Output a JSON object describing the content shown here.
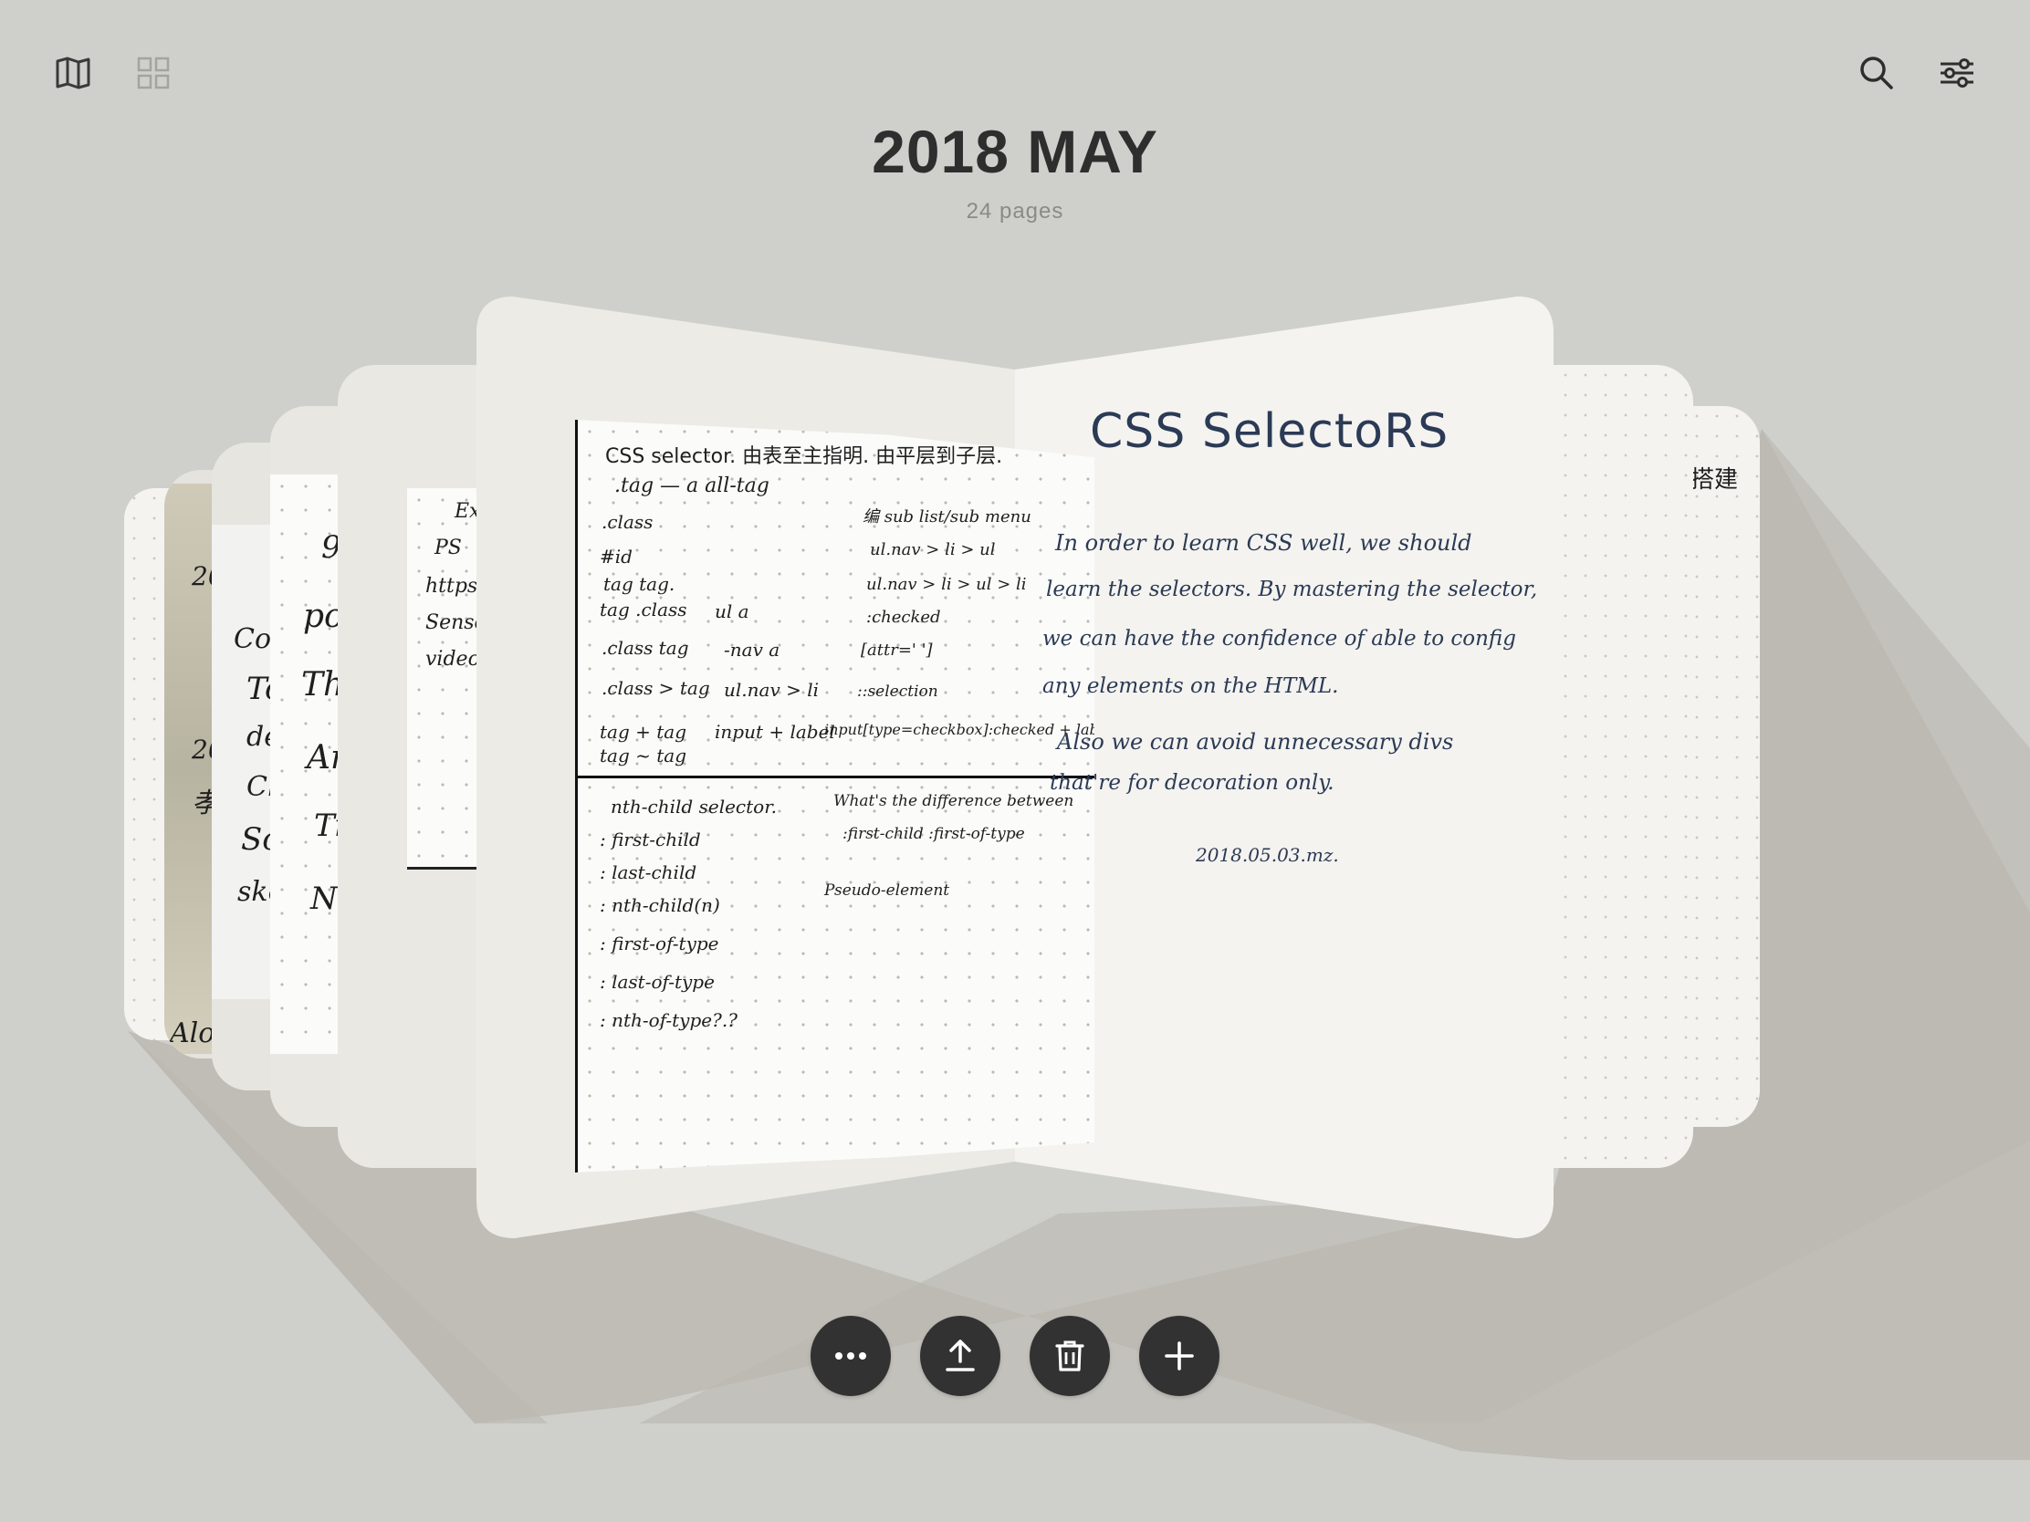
{
  "header": {
    "title": "2018 MAY",
    "subtitle": "24 pages"
  },
  "toolbar": {
    "left_icons": [
      "book-icon",
      "grid-icon"
    ],
    "right_icons": [
      "search-icon",
      "sliders-icon"
    ]
  },
  "notebook": {
    "left_page": {
      "heading": "CSS selector. 由表至主指明. 由平层到子层.",
      "lines_top_left": [
        ".tag — a all-tag",
        ".class",
        "#id",
        "tag tag.",
        "tag .class",
        ".class tag",
        ".class > tag",
        "tag + tag",
        "tag ~ tag"
      ],
      "lines_top_mid": [
        "ul a",
        "-nav a",
        "ul.nav > li"
      ],
      "lines_top_right": [
        "编 sub list/sub menu",
        "ul.nav > li > ul",
        "ul.nav > li > ul > li",
        ":checked",
        "[attr=' ']",
        "::selection",
        "input[type=checkbox]:checked + label"
      ],
      "input_label": "input + label",
      "lines_bottom_left": [
        "nth-child selector.",
        ": first-child",
        ": last-child",
        ": nth-child(n)",
        ": first-of-type",
        ": last-of-type",
        ": nth-of-type?.?"
      ],
      "lines_bottom_right": [
        "What's the difference between",
        ":first-child   :first-of-type",
        "Pseudo-element"
      ]
    },
    "right_page": {
      "heading": "CSS SelectoRS",
      "paragraph": [
        "In order to learn CSS well, we should",
        "learn the selectors. By mastering the selector,",
        "we can have the confidence of able to config",
        "any elements on the HTML."
      ],
      "paragraph2": [
        "Also we can avoid unnecessary divs",
        "that're for decoration only."
      ],
      "date": "2018.05.03.mz."
    },
    "side_snippets": {
      "left1": [
        "Ex",
        "PS",
        "https",
        "Senso",
        "video"
      ],
      "left2": [
        "9",
        "po",
        "Th",
        "An",
        "Ti",
        "N"
      ],
      "left3": [
        "Con",
        "To",
        "de",
        "Ch",
        "So",
        "ske"
      ],
      "left4": [
        "20",
        "孝",
        "Alo"
      ],
      "right1": "搭建"
    }
  },
  "actions": {
    "buttons": [
      "more-icon",
      "share-icon",
      "trash-icon",
      "add-icon"
    ]
  }
}
